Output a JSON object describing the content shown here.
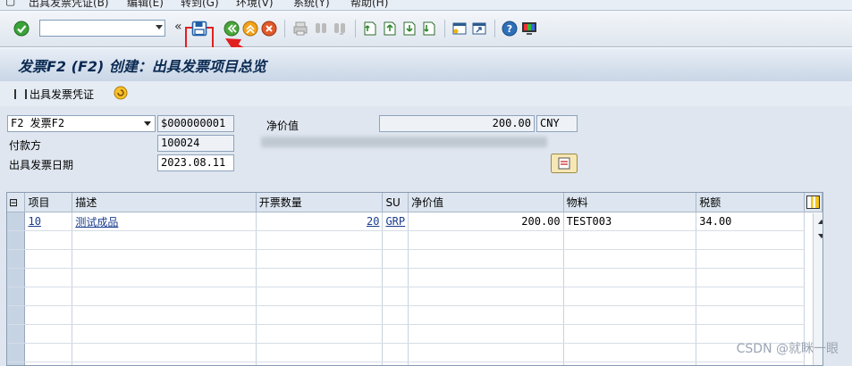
{
  "menu": [
    "出具发票凭证(B)",
    "编辑(E)",
    "转到(G)",
    "环境(V)",
    "系统(Y)",
    "帮助(H)"
  ],
  "toolbar": {
    "command_value": "",
    "icons": [
      "enter-icon",
      "command-field",
      "back-nav-icon",
      "save-icon",
      "back-icon",
      "exit-icon",
      "cancel-icon",
      "print-icon",
      "find-icon",
      "find-next-icon",
      "first-page-icon",
      "prev-page-icon",
      "next-page-icon",
      "last-page-icon",
      "new-session-icon",
      "shortcut-icon",
      "help-icon",
      "customize-layout-icon"
    ],
    "accent": "#e02020"
  },
  "page": {
    "title": "发票F2 (F2) 创建：出具发票项目总览"
  },
  "app_toolbar": {
    "button_label": "出具发票凭证"
  },
  "header": {
    "billing_type": "F2 发票F2",
    "doc_number": "$000000001",
    "net_value_label": "净价值",
    "net_value": "200.00",
    "currency": "CNY",
    "payer_label": "付款方",
    "payer": "100024",
    "date_label": "出具发票日期",
    "date": "2023.08.11"
  },
  "table": {
    "columns": [
      "项目",
      "描述",
      "开票数量",
      "SU",
      "净价值",
      "物料",
      "税额"
    ],
    "rows": [
      {
        "item": "10",
        "desc": "测试成品",
        "qty": "20",
        "su": "GRP",
        "net": "200.00",
        "material": "TEST003",
        "tax": "34.00"
      }
    ]
  },
  "watermark": "CSDN @就眯一眼"
}
